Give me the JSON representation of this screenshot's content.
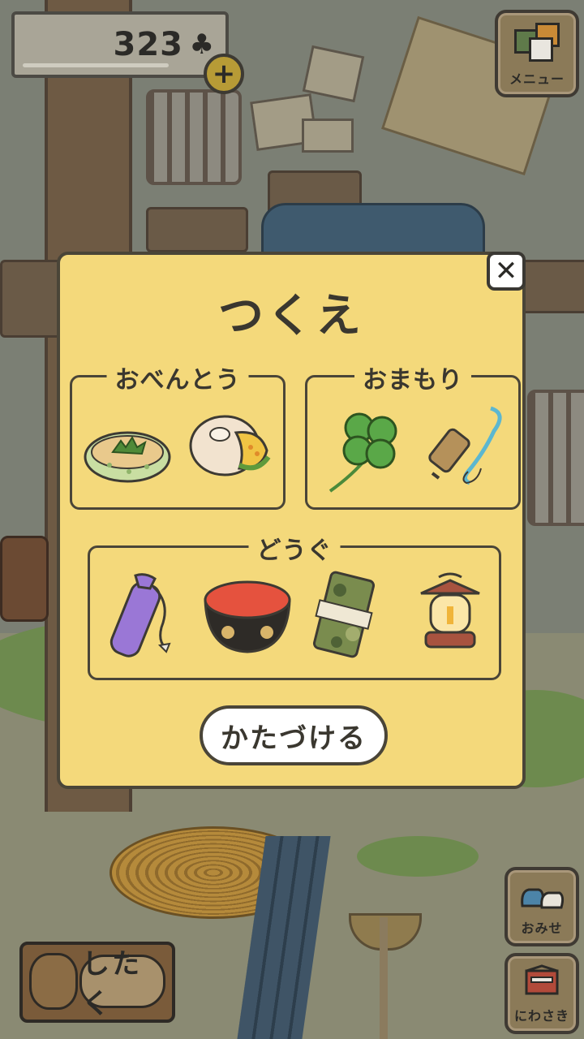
{
  "hud": {
    "clover_count": "323",
    "clover_icon": "♣",
    "plus_label": "+",
    "menu_label": "メニュー",
    "shop_label": "おみせ",
    "garden_label": "にわさき",
    "prepare_label": "したく"
  },
  "dialog": {
    "title": "つくえ",
    "close_label": "✕",
    "sections": [
      {
        "label": "おべんとう",
        "items": [
          "herb-bread-icon",
          "bagel-sandwich-icon"
        ]
      },
      {
        "label": "おまもり",
        "items": [
          "four-leaf-clover-icon",
          "bell-charm-icon"
        ]
      },
      {
        "label": "どうぐ",
        "items": [
          "purple-bottle-icon",
          "red-bowl-icon",
          "camo-towel-icon",
          "lantern-icon"
        ]
      }
    ],
    "cleanup_label": "かたづける"
  },
  "colors": {
    "dialog_bg": "#f4d97b",
    "outline": "#4a4538",
    "scene_dim": "#7b7f74"
  }
}
